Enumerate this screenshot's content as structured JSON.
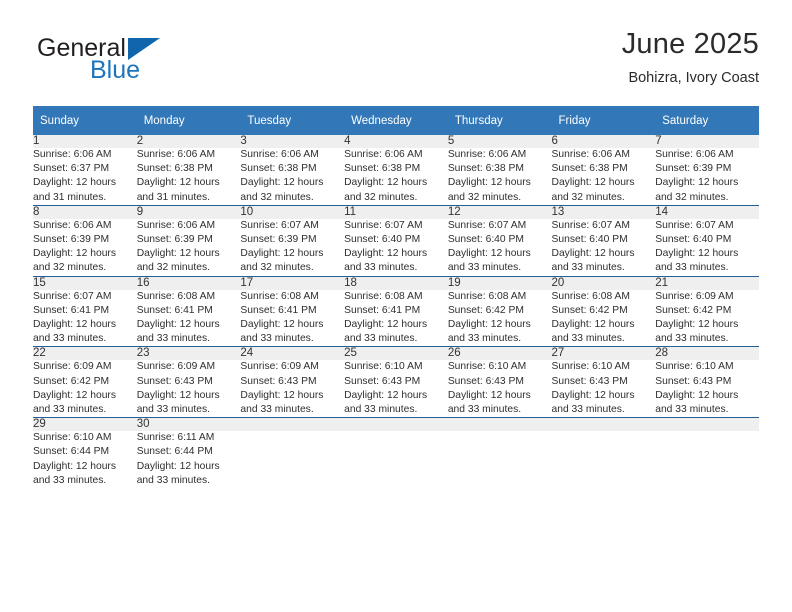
{
  "brand": {
    "name_top": "General",
    "name_bottom": "Blue",
    "logo_icon": "triangle-flag-icon",
    "color_dark": "#231f20",
    "color_blue": "#1e74bb"
  },
  "header": {
    "title": "June 2025",
    "subtitle": "Bohizra, Ivory Coast"
  },
  "theme": {
    "header_bg": "#3277b8",
    "header_text": "#ffffff",
    "row_divider": "#245f98",
    "daynum_bg": "#efefef"
  },
  "calendar": {
    "weekday_headers": [
      "Sunday",
      "Monday",
      "Tuesday",
      "Wednesday",
      "Thursday",
      "Friday",
      "Saturday"
    ],
    "weeks": [
      [
        null,
        null,
        null,
        null,
        null,
        null,
        null
      ],
      [
        null,
        null,
        null,
        null,
        null,
        null,
        null
      ],
      [
        null,
        null,
        null,
        null,
        null,
        null,
        null
      ],
      [
        null,
        null,
        null,
        null,
        null,
        null,
        null
      ],
      [
        null,
        null,
        null,
        null,
        null,
        null,
        null
      ]
    ],
    "days": [
      {
        "day": "1",
        "week": 0,
        "col": 0,
        "sunrise": "Sunrise: 6:06 AM",
        "sunset": "Sunset: 6:37 PM",
        "daylight_line1": "Daylight: 12 hours",
        "daylight_line2": "and 31 minutes."
      },
      {
        "day": "2",
        "week": 0,
        "col": 1,
        "sunrise": "Sunrise: 6:06 AM",
        "sunset": "Sunset: 6:38 PM",
        "daylight_line1": "Daylight: 12 hours",
        "daylight_line2": "and 31 minutes."
      },
      {
        "day": "3",
        "week": 0,
        "col": 2,
        "sunrise": "Sunrise: 6:06 AM",
        "sunset": "Sunset: 6:38 PM",
        "daylight_line1": "Daylight: 12 hours",
        "daylight_line2": "and 32 minutes."
      },
      {
        "day": "4",
        "week": 0,
        "col": 3,
        "sunrise": "Sunrise: 6:06 AM",
        "sunset": "Sunset: 6:38 PM",
        "daylight_line1": "Daylight: 12 hours",
        "daylight_line2": "and 32 minutes."
      },
      {
        "day": "5",
        "week": 0,
        "col": 4,
        "sunrise": "Sunrise: 6:06 AM",
        "sunset": "Sunset: 6:38 PM",
        "daylight_line1": "Daylight: 12 hours",
        "daylight_line2": "and 32 minutes."
      },
      {
        "day": "6",
        "week": 0,
        "col": 5,
        "sunrise": "Sunrise: 6:06 AM",
        "sunset": "Sunset: 6:38 PM",
        "daylight_line1": "Daylight: 12 hours",
        "daylight_line2": "and 32 minutes."
      },
      {
        "day": "7",
        "week": 0,
        "col": 6,
        "sunrise": "Sunrise: 6:06 AM",
        "sunset": "Sunset: 6:39 PM",
        "daylight_line1": "Daylight: 12 hours",
        "daylight_line2": "and 32 minutes."
      },
      {
        "day": "8",
        "week": 1,
        "col": 0,
        "sunrise": "Sunrise: 6:06 AM",
        "sunset": "Sunset: 6:39 PM",
        "daylight_line1": "Daylight: 12 hours",
        "daylight_line2": "and 32 minutes."
      },
      {
        "day": "9",
        "week": 1,
        "col": 1,
        "sunrise": "Sunrise: 6:06 AM",
        "sunset": "Sunset: 6:39 PM",
        "daylight_line1": "Daylight: 12 hours",
        "daylight_line2": "and 32 minutes."
      },
      {
        "day": "10",
        "week": 1,
        "col": 2,
        "sunrise": "Sunrise: 6:07 AM",
        "sunset": "Sunset: 6:39 PM",
        "daylight_line1": "Daylight: 12 hours",
        "daylight_line2": "and 32 minutes."
      },
      {
        "day": "11",
        "week": 1,
        "col": 3,
        "sunrise": "Sunrise: 6:07 AM",
        "sunset": "Sunset: 6:40 PM",
        "daylight_line1": "Daylight: 12 hours",
        "daylight_line2": "and 33 minutes."
      },
      {
        "day": "12",
        "week": 1,
        "col": 4,
        "sunrise": "Sunrise: 6:07 AM",
        "sunset": "Sunset: 6:40 PM",
        "daylight_line1": "Daylight: 12 hours",
        "daylight_line2": "and 33 minutes."
      },
      {
        "day": "13",
        "week": 1,
        "col": 5,
        "sunrise": "Sunrise: 6:07 AM",
        "sunset": "Sunset: 6:40 PM",
        "daylight_line1": "Daylight: 12 hours",
        "daylight_line2": "and 33 minutes."
      },
      {
        "day": "14",
        "week": 1,
        "col": 6,
        "sunrise": "Sunrise: 6:07 AM",
        "sunset": "Sunset: 6:40 PM",
        "daylight_line1": "Daylight: 12 hours",
        "daylight_line2": "and 33 minutes."
      },
      {
        "day": "15",
        "week": 2,
        "col": 0,
        "sunrise": "Sunrise: 6:07 AM",
        "sunset": "Sunset: 6:41 PM",
        "daylight_line1": "Daylight: 12 hours",
        "daylight_line2": "and 33 minutes."
      },
      {
        "day": "16",
        "week": 2,
        "col": 1,
        "sunrise": "Sunrise: 6:08 AM",
        "sunset": "Sunset: 6:41 PM",
        "daylight_line1": "Daylight: 12 hours",
        "daylight_line2": "and 33 minutes."
      },
      {
        "day": "17",
        "week": 2,
        "col": 2,
        "sunrise": "Sunrise: 6:08 AM",
        "sunset": "Sunset: 6:41 PM",
        "daylight_line1": "Daylight: 12 hours",
        "daylight_line2": "and 33 minutes."
      },
      {
        "day": "18",
        "week": 2,
        "col": 3,
        "sunrise": "Sunrise: 6:08 AM",
        "sunset": "Sunset: 6:41 PM",
        "daylight_line1": "Daylight: 12 hours",
        "daylight_line2": "and 33 minutes."
      },
      {
        "day": "19",
        "week": 2,
        "col": 4,
        "sunrise": "Sunrise: 6:08 AM",
        "sunset": "Sunset: 6:42 PM",
        "daylight_line1": "Daylight: 12 hours",
        "daylight_line2": "and 33 minutes."
      },
      {
        "day": "20",
        "week": 2,
        "col": 5,
        "sunrise": "Sunrise: 6:08 AM",
        "sunset": "Sunset: 6:42 PM",
        "daylight_line1": "Daylight: 12 hours",
        "daylight_line2": "and 33 minutes."
      },
      {
        "day": "21",
        "week": 2,
        "col": 6,
        "sunrise": "Sunrise: 6:09 AM",
        "sunset": "Sunset: 6:42 PM",
        "daylight_line1": "Daylight: 12 hours",
        "daylight_line2": "and 33 minutes."
      },
      {
        "day": "22",
        "week": 3,
        "col": 0,
        "sunrise": "Sunrise: 6:09 AM",
        "sunset": "Sunset: 6:42 PM",
        "daylight_line1": "Daylight: 12 hours",
        "daylight_line2": "and 33 minutes."
      },
      {
        "day": "23",
        "week": 3,
        "col": 1,
        "sunrise": "Sunrise: 6:09 AM",
        "sunset": "Sunset: 6:43 PM",
        "daylight_line1": "Daylight: 12 hours",
        "daylight_line2": "and 33 minutes."
      },
      {
        "day": "24",
        "week": 3,
        "col": 2,
        "sunrise": "Sunrise: 6:09 AM",
        "sunset": "Sunset: 6:43 PM",
        "daylight_line1": "Daylight: 12 hours",
        "daylight_line2": "and 33 minutes."
      },
      {
        "day": "25",
        "week": 3,
        "col": 3,
        "sunrise": "Sunrise: 6:10 AM",
        "sunset": "Sunset: 6:43 PM",
        "daylight_line1": "Daylight: 12 hours",
        "daylight_line2": "and 33 minutes."
      },
      {
        "day": "26",
        "week": 3,
        "col": 4,
        "sunrise": "Sunrise: 6:10 AM",
        "sunset": "Sunset: 6:43 PM",
        "daylight_line1": "Daylight: 12 hours",
        "daylight_line2": "and 33 minutes."
      },
      {
        "day": "27",
        "week": 3,
        "col": 5,
        "sunrise": "Sunrise: 6:10 AM",
        "sunset": "Sunset: 6:43 PM",
        "daylight_line1": "Daylight: 12 hours",
        "daylight_line2": "and 33 minutes."
      },
      {
        "day": "28",
        "week": 3,
        "col": 6,
        "sunrise": "Sunrise: 6:10 AM",
        "sunset": "Sunset: 6:43 PM",
        "daylight_line1": "Daylight: 12 hours",
        "daylight_line2": "and 33 minutes."
      },
      {
        "day": "29",
        "week": 4,
        "col": 0,
        "sunrise": "Sunrise: 6:10 AM",
        "sunset": "Sunset: 6:44 PM",
        "daylight_line1": "Daylight: 12 hours",
        "daylight_line2": "and 33 minutes."
      },
      {
        "day": "30",
        "week": 4,
        "col": 1,
        "sunrise": "Sunrise: 6:11 AM",
        "sunset": "Sunset: 6:44 PM",
        "daylight_line1": "Daylight: 12 hours",
        "daylight_line2": "and 33 minutes."
      }
    ]
  }
}
